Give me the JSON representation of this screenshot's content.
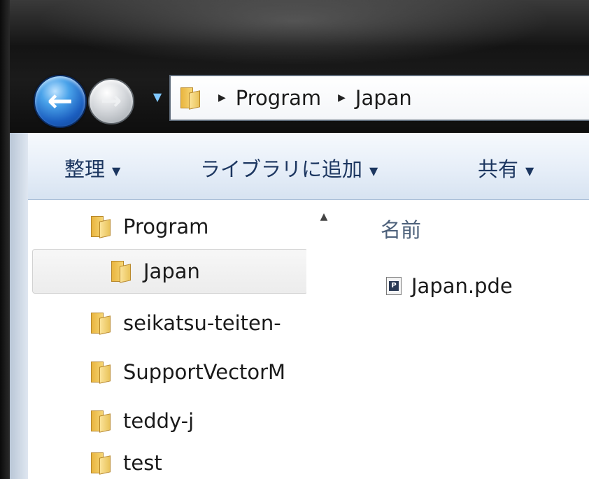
{
  "address_bar": {
    "crumbs": [
      "Program",
      "Japan"
    ]
  },
  "command_bar": {
    "organize_label": "整理",
    "add_to_library_label": "ライブラリに追加",
    "share_label": "共有"
  },
  "navigation_pane": {
    "items": [
      {
        "label": "Program"
      },
      {
        "label": "Japan"
      },
      {
        "label": "seikatsu-teiten-"
      },
      {
        "label": "SupportVectorM"
      },
      {
        "label": "teddy-j"
      },
      {
        "label": "test"
      }
    ]
  },
  "content_pane": {
    "column_header": "名前",
    "files": [
      {
        "name": "Japan.pde",
        "icon": "processing-file-icon",
        "icon_letter": "P"
      }
    ]
  },
  "colors": {
    "command_text": "#1c3660",
    "column_header": "#4c607a",
    "back_button": "#1c5fc0"
  }
}
